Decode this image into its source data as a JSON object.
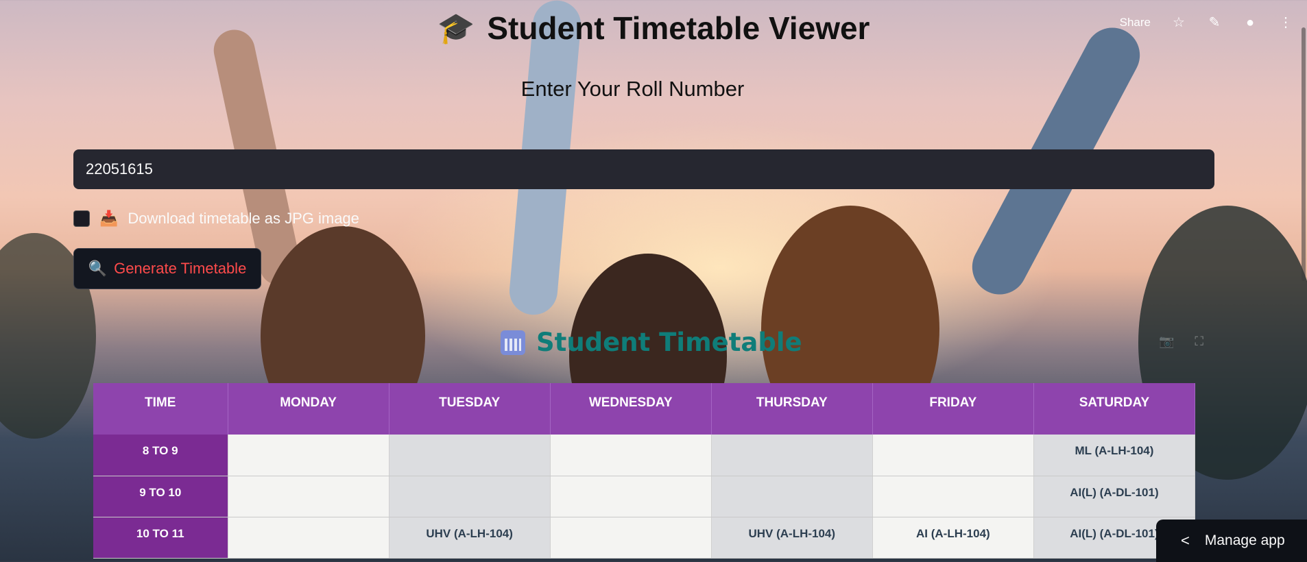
{
  "header": {
    "share_label": "Share",
    "icons": [
      "star-icon",
      "pencil-icon",
      "github-icon",
      "more-vert-icon"
    ]
  },
  "app": {
    "title": "Student Timetable Viewer",
    "title_icon": "graduation-cap-icon",
    "subtitle": "Enter Your Roll Number",
    "roll_number": "22051615",
    "download_checkbox_label": "Download timetable as JPG image",
    "download_checked": false,
    "generate_button_label": "Generate Timetable",
    "timetable_heading": "Student Timetable",
    "accent_color": "#ff4b4b",
    "header_color": "#8e44ad",
    "heading_color": "#0f7d79"
  },
  "timetable": {
    "headers": [
      "TIME",
      "MONDAY",
      "TUESDAY",
      "WEDNESDAY",
      "THURSDAY",
      "FRIDAY",
      "SATURDAY"
    ],
    "rows": [
      [
        "8 TO 9",
        "",
        "",
        "",
        "",
        "",
        "ML (A-LH-104)"
      ],
      [
        "9 TO 10",
        "",
        "",
        "",
        "",
        "",
        "AI(L) (A-DL-101)"
      ],
      [
        "10 TO 11",
        "",
        "UHV (A-LH-104)",
        "",
        "UHV (A-LH-104)",
        "AI (A-LH-104)",
        "AI(L) (A-DL-101)"
      ]
    ]
  },
  "footer": {
    "manage_label": "Manage app"
  }
}
